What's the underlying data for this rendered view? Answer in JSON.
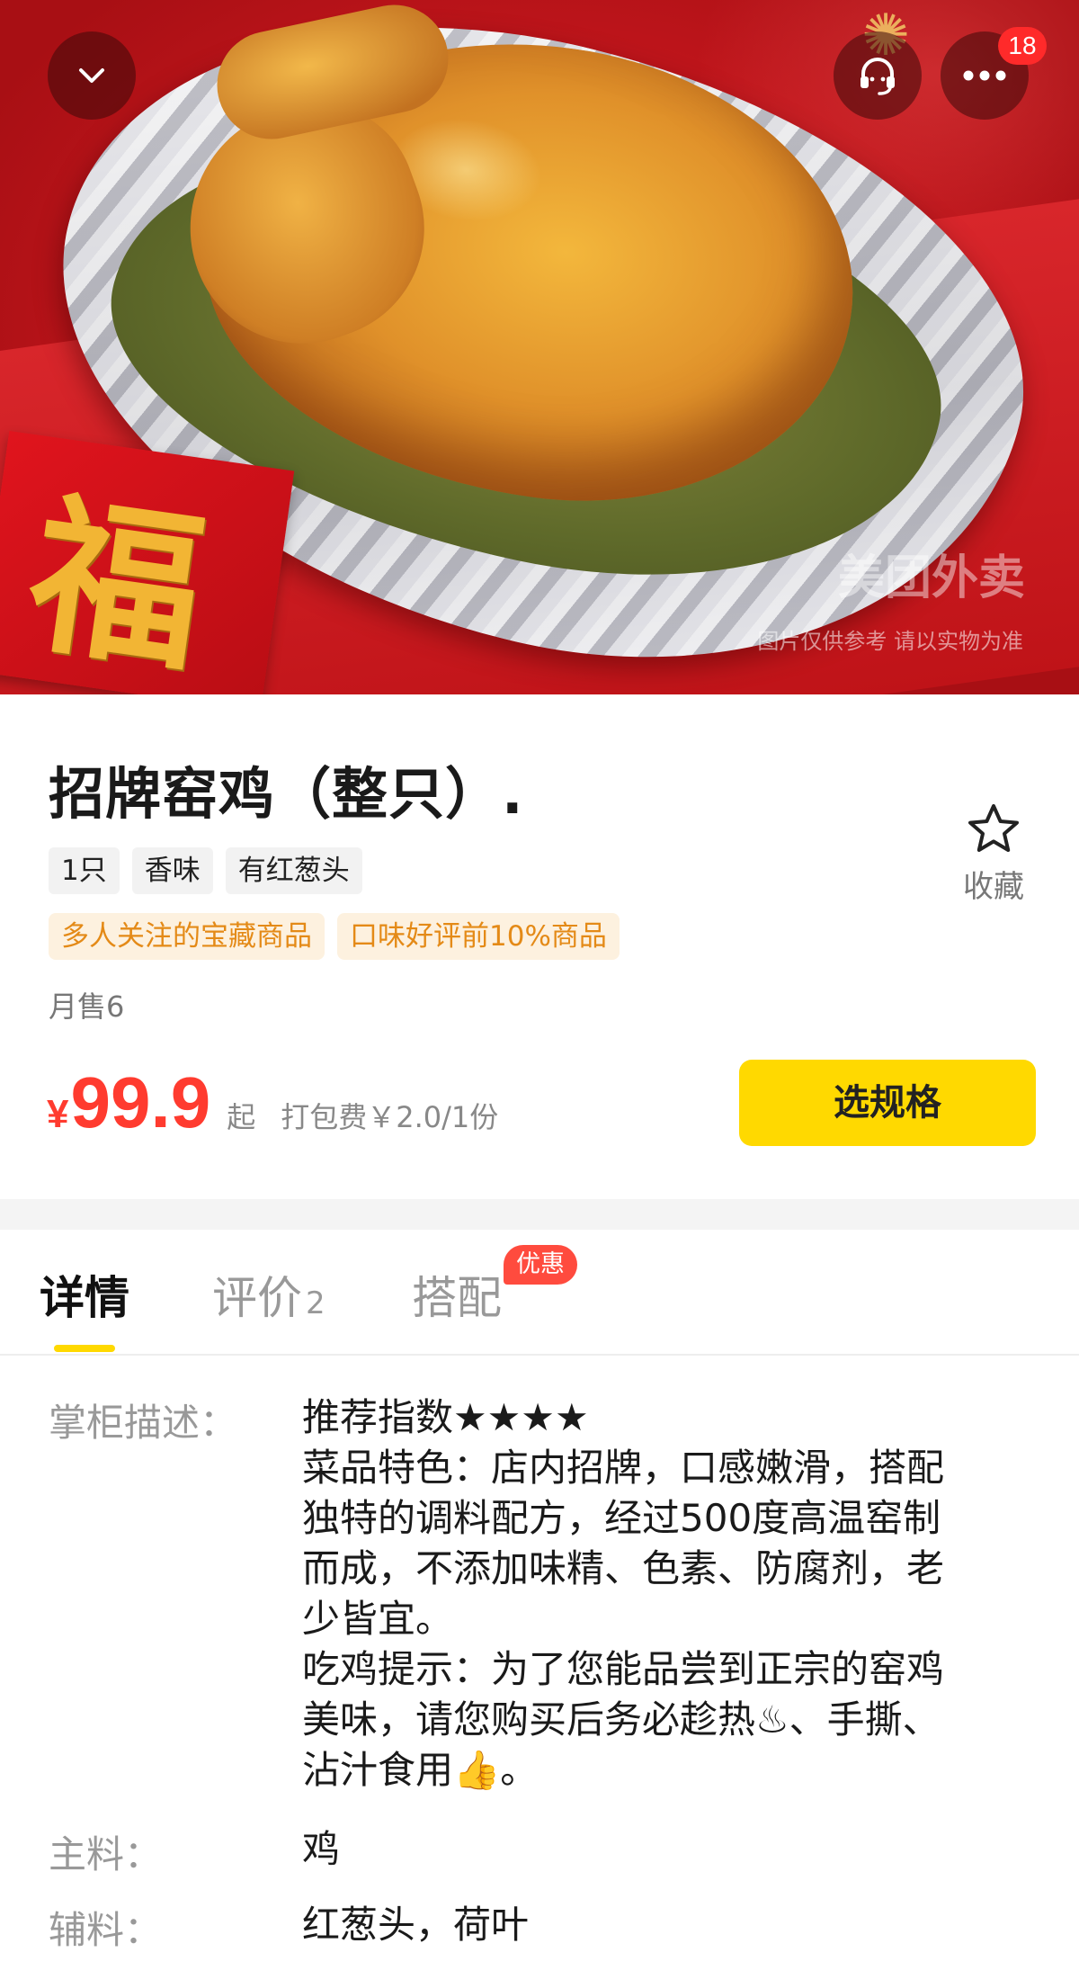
{
  "hero": {
    "watermark_brand": "美团外卖",
    "watermark_note": "图片仅供参考 请以实物为准",
    "decor_char": "福"
  },
  "topbar": {
    "message_count": "18",
    "icons": [
      "chevron-down-icon",
      "customer-service-icon",
      "more-icon"
    ]
  },
  "product": {
    "title": "招牌窑鸡（整只）.",
    "tags": [
      "1只",
      "香味",
      "有红葱头"
    ],
    "badges": [
      "多人关注的宝藏商品",
      "口味好评前10%商品"
    ],
    "monthly_sales": "月售6",
    "favorite_label": "收藏",
    "currency": "¥",
    "price": "99.9",
    "price_suffix": "起",
    "packing_fee": "打包费￥2.0/1份",
    "select_spec_label": "选规格"
  },
  "tabs": {
    "detail": "详情",
    "review": "评价",
    "review_count": "2",
    "combo": "搭配",
    "combo_badge": "优惠"
  },
  "details": {
    "desc_label": "掌柜描述：",
    "desc_lines": [
      "推荐指数★★★★",
      "菜品特色：店内招牌，口感嫩滑，搭配",
      "独特的调料配方，经过500度高温窑制",
      "而成，不添加味精、色素、防腐剂，老",
      "少皆宜。",
      "吃鸡提示：为了您能品尝到正宗的窑鸡",
      "美味，请您购买后务必趁热♨、手撕、",
      "沾汁食用👍。"
    ],
    "main_label": "主料：",
    "main_value": "鸡",
    "aux_label": "辅料：",
    "aux_value": "红葱头，荷叶"
  },
  "colors": {
    "accent_yellow": "#ffd900",
    "price_red": "#ff3b2f",
    "badge_orange": "#e48a17",
    "badge_bg": "#fdf1df"
  }
}
